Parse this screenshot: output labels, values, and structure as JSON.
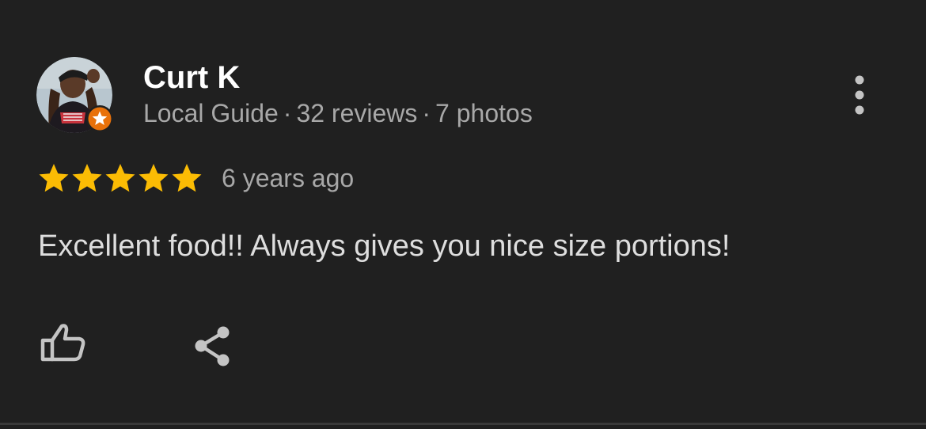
{
  "review": {
    "author": {
      "name": "Curt K",
      "level": "Local Guide",
      "separator": "·",
      "reviews": "32 reviews",
      "photos": "7 photos",
      "avatar_icon": "user-avatar-photo",
      "badge_icon": "local-guide-star-badge",
      "badge_color": "#e8710a"
    },
    "rating": 5,
    "rating_max": 5,
    "star_color": "#fbbc04",
    "time": "6 years ago",
    "text": "Excellent food!! Always gives you nice size portions!",
    "actions": {
      "like_icon": "thumbs-up-icon",
      "share_icon": "share-icon",
      "more_icon": "more-vertical-icon"
    }
  },
  "theme": {
    "background": "#202020",
    "name_color": "#ffffff",
    "secondary_text": "#a8a8a8",
    "body_text": "#dedede",
    "icon_color": "#c4c4c4"
  }
}
